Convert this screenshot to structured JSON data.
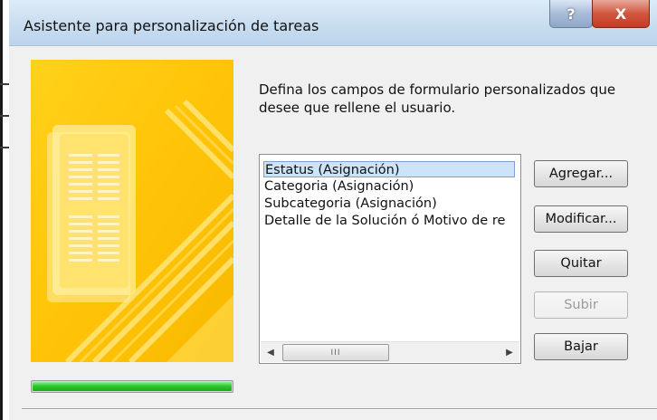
{
  "window": {
    "title": "Asistente para personalización de tareas",
    "help_label": "?",
    "close_label": "X"
  },
  "instructions": "Defina los campos de formulario personalizados que desee que rellene el usuario.",
  "fields_list": {
    "items": [
      {
        "label": "Estatus (Asignación)",
        "selected": true
      },
      {
        "label": "Categoria (Asignación)",
        "selected": false
      },
      {
        "label": "Subcategoria (Asignación)",
        "selected": false
      },
      {
        "label": "Detalle de la Solución ó Motivo de re",
        "selected": false
      }
    ],
    "scroll_left_glyph": "◀",
    "scroll_right_glyph": "▶",
    "scroll_thumb_grip": "III"
  },
  "buttons": {
    "add": "Agregar...",
    "modify": "Modificar...",
    "remove": "Quitar",
    "up": "Subir",
    "down": "Bajar"
  },
  "progress": {
    "value": 1.0,
    "color": "#2ec82e"
  },
  "colors": {
    "wizard_image": "#ffc80a",
    "selection": "#cce4f7"
  },
  "icons": {
    "wizard": "wizard-form-illustration"
  }
}
